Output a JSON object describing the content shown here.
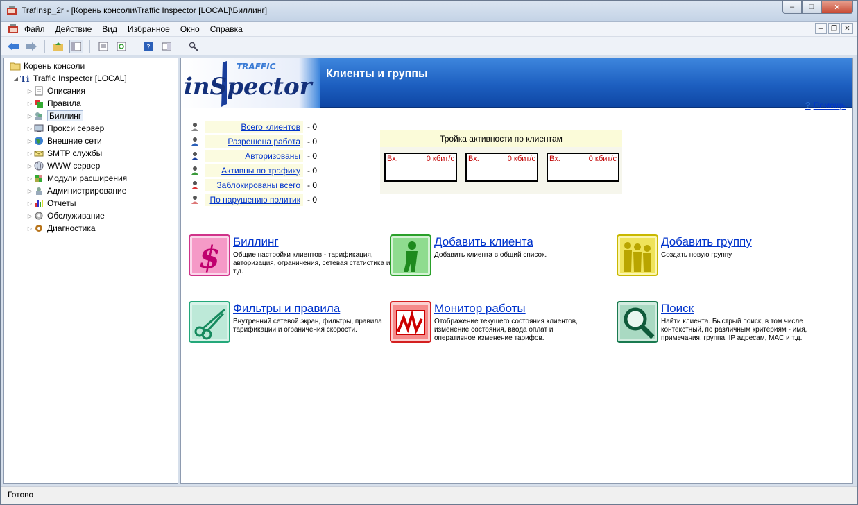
{
  "window": {
    "title": "TrafInsp_2r - [Корень консоли\\Traffic Inspector [LOCAL]\\Биллинг]",
    "minimize": "–",
    "maximize": "□",
    "close": "✕"
  },
  "menu": {
    "items": [
      "Файл",
      "Действие",
      "Вид",
      "Избранное",
      "Окно",
      "Справка"
    ]
  },
  "tree": {
    "root": "Корень консоли",
    "server": "Traffic Inspector [LOCAL]",
    "items": [
      "Описания",
      "Правила",
      "Биллинг",
      "Прокси сервер",
      "Внешние сети",
      "SMTP службы",
      "WWW сервер",
      "Модули расширения",
      "Администрирование",
      "Отчеты",
      "Обслуживание",
      "Диагностика"
    ]
  },
  "content": {
    "logo_top": "TRAFFIC",
    "logo_main": "inSpector",
    "title": "Клиенты и группы",
    "help": "Помощь",
    "stats": [
      {
        "label": "Всего клиентов",
        "value": "- 0"
      },
      {
        "label": "Разрешена работа",
        "value": "- 0"
      },
      {
        "label": "Авторизованы",
        "value": "- 0"
      },
      {
        "label": "Активны по трафику",
        "value": "- 0"
      },
      {
        "label": "Заблокированы всего",
        "value": "- 0"
      },
      {
        "label": "По нарушению политик",
        "value": "- 0"
      }
    ],
    "top3": {
      "title": "Тройка активности по клиентам",
      "boxes": [
        {
          "label": "Вх.",
          "value": "0 кбит/с"
        },
        {
          "label": "Вх.",
          "value": "0 кбит/с"
        },
        {
          "label": "Вх.",
          "value": "0 кбит/с"
        }
      ]
    },
    "actions": [
      {
        "title": "Биллинг",
        "desc": "Общие настройки клиентов - тарификация, авторизация, ограничения, сетевая статистика и т.д."
      },
      {
        "title": "Добавить клиента",
        "desc": "Добавить клиента в общий список."
      },
      {
        "title": "Добавить группу",
        "desc": "Создать новую группу."
      },
      {
        "title": "Фильтры и правила",
        "desc": "Внутренний сетевой экран, фильтры, правила тарификации и ограничения скорости."
      },
      {
        "title": "Монитор работы",
        "desc": "Отображение текущего состояния клиентов, изменение состояния, ввода оплат и оперативное изменение тарифов."
      },
      {
        "title": "Поиск",
        "desc": "Найти клиента. Быстрый поиск, в том числе контекстный, по различным критериям - имя, примечания, группа, IP адресам, MAC и т.д."
      }
    ]
  },
  "status": {
    "text": "Готово"
  },
  "colors": {
    "banner": "#1d5fc0",
    "link": "#0033cc",
    "stat_bg": "#fbfbe0",
    "rate_text": "#c00000"
  }
}
